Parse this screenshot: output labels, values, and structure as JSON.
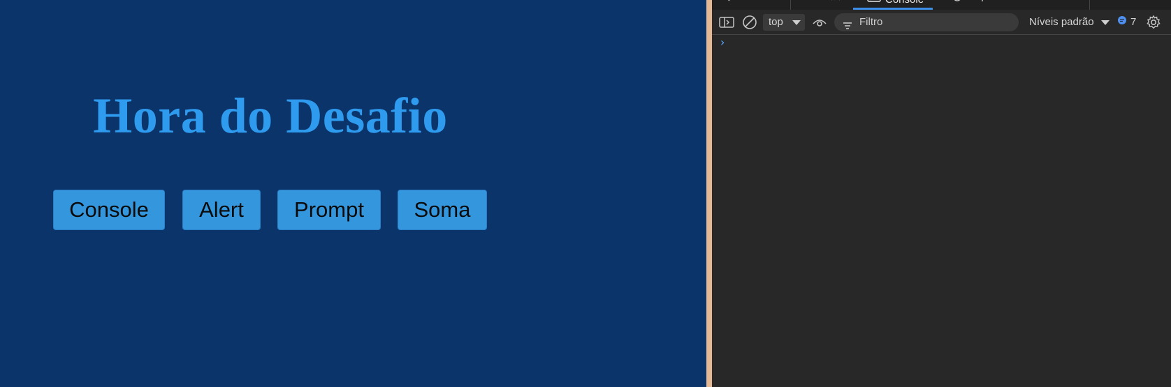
{
  "page": {
    "heading": "Hora do Desafio",
    "buttons": [
      "Console",
      "Alert",
      "Prompt",
      "Soma"
    ]
  },
  "devtools": {
    "tabs": {
      "console_label": "Console"
    },
    "toolbar": {
      "context": "top",
      "filter_placeholder": "Filtro",
      "levels": "Níveis padrão",
      "issues_count": "7"
    },
    "prompt_glyph": "›"
  },
  "colors": {
    "page_background": "#0b346b",
    "heading": "#2f9bef",
    "button": "#3497de",
    "devtools_background": "#282828",
    "splitter": "#e6b893",
    "accent": "#3c8ee8"
  },
  "icons": [
    "inspect-icon",
    "device-toolbar-icon",
    "sidebar-toggle-icon",
    "clear-console-icon",
    "live-expression-eye-icon",
    "filter-icon",
    "issues-chat-icon",
    "settings-gear-icon",
    "elements-icon",
    "sources-icon",
    "console-icon",
    "performance-bug-icon",
    "network-icon",
    "memory-icon"
  ]
}
